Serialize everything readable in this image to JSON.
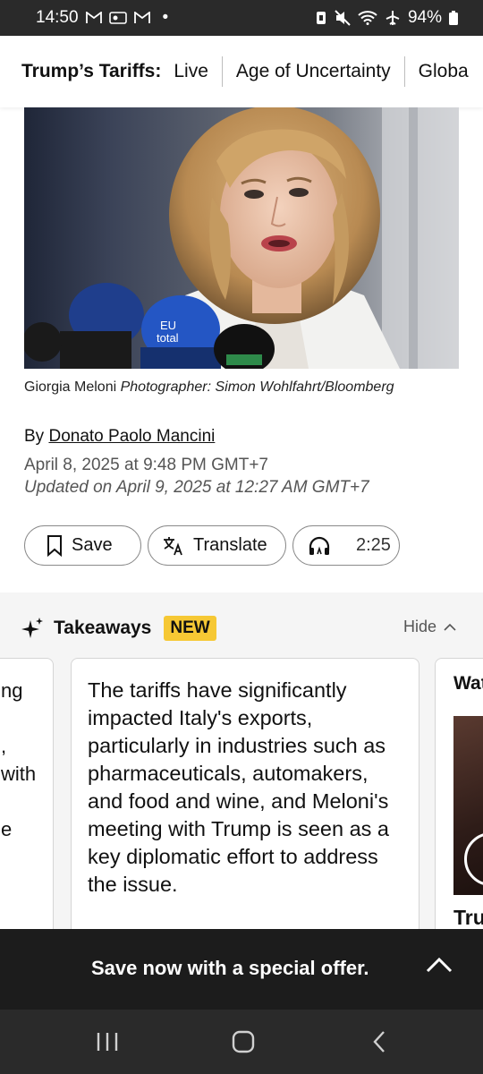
{
  "status_bar": {
    "time": "14:50",
    "left_icons": [
      "gmail-icon",
      "vpn-card-icon",
      "gmail-icon"
    ],
    "dot": "•",
    "right_icons": [
      "vibrate-icon",
      "mute-icon",
      "wifi-icon",
      "airplane-icon"
    ],
    "battery": "94%"
  },
  "tab_strip": {
    "label": "Trump’s Tariffs:",
    "tabs": [
      "Live",
      "Age of Uncertainty",
      "Globa"
    ]
  },
  "photo": {
    "caption_subject": "Giorgia Meloni",
    "caption_credit": "Photographer: Simon Wohlfahrt/Bloomberg",
    "mic_labels": [
      "EU",
      "total"
    ]
  },
  "byline": {
    "prefix": "By",
    "author": "Donato Paolo Mancini",
    "date": "April 8, 2025 at 9:48 PM GMT+7",
    "updated": "Updated on April 9, 2025 at 12:27 AM GMT+7"
  },
  "actions": {
    "save": "Save",
    "translate": "Translate",
    "listen": "2:25"
  },
  "takeaways": {
    "title": "Takeaways",
    "badge": "NEW",
    "hide": "Hide",
    "left_fragments": [
      "ng",
      "",
      ",",
      "with",
      "",
      "e"
    ],
    "main_text": "The tariffs have significantly impacted Italy's exports, particularly in industries such as pharmaceuticals, automakers, and food and wine, and Meloni's meeting with Trump is seen as a key diplomatic effort to address the issue.",
    "right_title": "Wat",
    "right_bottom": "Tru"
  },
  "offer": {
    "text": "Save now with a special offer."
  },
  "colors": {
    "badge": "#f6c834",
    "offer_bar": "#1c1c1c",
    "status_bar": "#2a2a2a"
  }
}
